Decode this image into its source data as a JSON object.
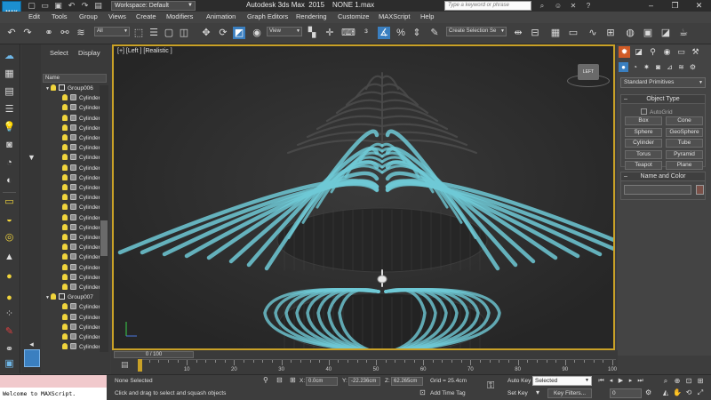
{
  "titlebar": {
    "app_icon_text": "MAX",
    "workspace": "Workspace: Default",
    "title": "Autodesk 3ds Max  2015    NONE 1.max",
    "search_placeholder": "Type a keyword or phrase"
  },
  "menu": [
    "Edit",
    "Tools",
    "Group",
    "Views",
    "Create",
    "Modifiers",
    "Animation",
    "Graph Editors",
    "Rendering",
    "Customize",
    "MAXScript",
    "Help"
  ],
  "toolbar": {
    "filter_value": "All",
    "refcoord_value": "View",
    "selection_set_placeholder": "Create Selection Se"
  },
  "explorer": {
    "tab_select": "Select",
    "tab_display": "Display",
    "column_header": "Name",
    "group1": "Group006",
    "group2": "Group007",
    "child_label": "Cylinder"
  },
  "viewport": {
    "label": "[+] [Left ] [Realistic ]",
    "viewcube_label": "LEFT"
  },
  "command_panel": {
    "category": "Standard Primitives",
    "object_type_title": "Object Type",
    "autogrid_label": "AutoGrid",
    "buttons": [
      "Box",
      "Cone",
      "Sphere",
      "GeoSphere",
      "Cylinder",
      "Tube",
      "Torus",
      "Pyramid",
      "Teapot",
      "Plane"
    ],
    "name_color_title": "Name and Color"
  },
  "timeline": {
    "slider_label": "0 / 100",
    "ticks": [
      "0",
      "10",
      "20",
      "30",
      "40",
      "50",
      "60",
      "70",
      "80",
      "90",
      "100"
    ]
  },
  "status": {
    "maxscript_output": "Welcome to MAXScript.",
    "selection_status": "None Selected",
    "prompt": "Click and drag to select and squash objects",
    "x_label": "X:",
    "x_value": "0.0cm",
    "y_label": "Y:",
    "y_value": "-22.236cm",
    "z_label": "Z:",
    "z_value": "62.265cm",
    "grid": "Grid = 25.4cm",
    "add_time_tag": "Add Time Tag",
    "auto_key": "Auto Key",
    "selected_value": "Selected",
    "set_key": "Set Key",
    "key_filters": "Key Filters...",
    "frame_value": "0"
  },
  "colors": {
    "accent": "#3a7fc0",
    "viewport_border": "#c9a127",
    "command_tab_active": "#d05b26",
    "ribs_primary": "#6fc9d6",
    "ribs_dark": "#4a4a4a"
  },
  "icons": [
    "undo-icon",
    "redo-icon",
    "link-icon",
    "unlink-icon",
    "bind-icon",
    "select-icon",
    "move-icon",
    "rotate-icon",
    "scale-icon",
    "snap-icon",
    "render-icon",
    "search-icon",
    "close-icon",
    "minimize-icon",
    "maximize-icon"
  ]
}
